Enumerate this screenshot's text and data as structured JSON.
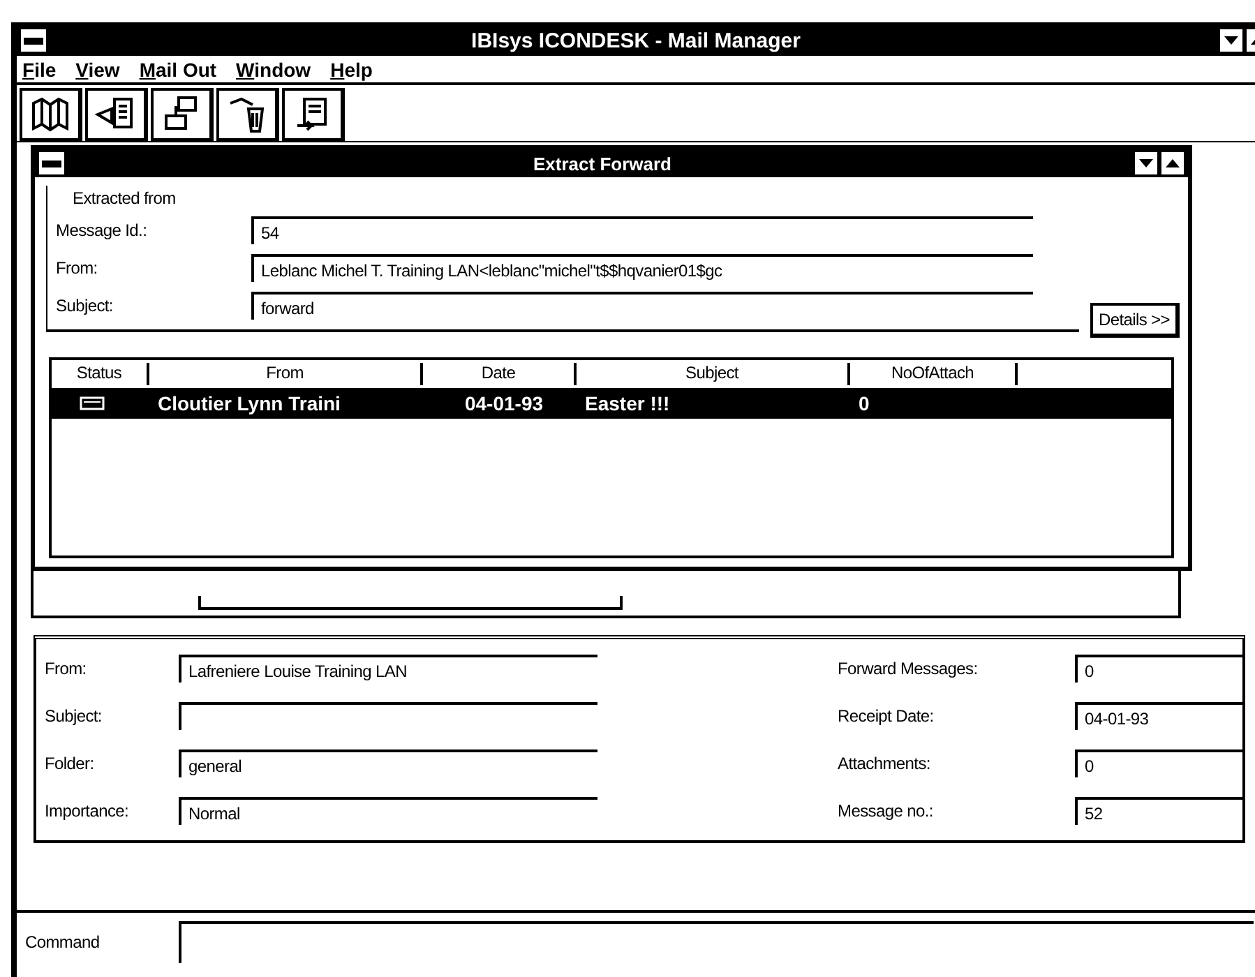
{
  "window": {
    "title": "IBIsys ICONDESK - Mail Manager"
  },
  "menu": [
    {
      "label": "File"
    },
    {
      "label": "View"
    },
    {
      "label": "Mail Out"
    },
    {
      "label": "Window"
    },
    {
      "label": "Help"
    }
  ],
  "dialog": {
    "title": "Extract Forward",
    "group_label": "Extracted from",
    "fields": [
      {
        "label": "Message Id.:",
        "value": "54"
      },
      {
        "label": "From:",
        "value": "Leblanc Michel T. Training LAN<leblanc\"michel\"t$$hqvanier01$gc"
      },
      {
        "label": "Subject:",
        "value": "forward"
      }
    ],
    "details_button": "Details >>",
    "table": {
      "columns": [
        "Status",
        "From",
        "Date",
        "Subject",
        "NoOfAttach"
      ],
      "rows": [
        {
          "from": "Cloutier Lynn Traini",
          "date": "04-01-93",
          "subject": "Easter !!!",
          "attachments": "0",
          "selected": true
        }
      ]
    }
  },
  "message_panel": {
    "left_fields": [
      {
        "label": "From:",
        "value": "Lafreniere Louise Training LAN"
      },
      {
        "label": "Subject:"
      },
      {
        "label": "Folder:",
        "value": "general"
      },
      {
        "label": "Importance:",
        "value": "Normal"
      }
    ],
    "right_fields": [
      {
        "label": "Forward Messages:",
        "value": "0"
      },
      {
        "label": "Receipt Date:",
        "value": "04-01-93"
      },
      {
        "label": "Attachments:",
        "value": "0"
      },
      {
        "label": "Message no.:",
        "value": "52"
      }
    ]
  },
  "command": {
    "label": "Command"
  }
}
